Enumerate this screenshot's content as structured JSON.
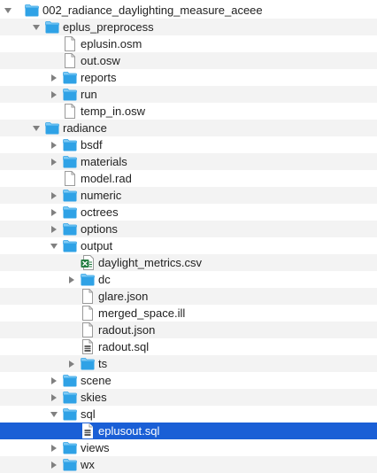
{
  "colors": {
    "folder": "#2fa2e6",
    "folder_tab": "#7fcaf4",
    "selection": "#1a5fd6",
    "alternate_row": "#f3f3f3",
    "disclosure_triangle": "#808080",
    "excel_green": "#1f7a3d"
  },
  "tree": [
    {
      "depth": 0,
      "label": "002_radiance_daylighting_measure_aceee",
      "icon": "folder-icon",
      "expand": "expanded"
    },
    {
      "depth": 1,
      "label": "eplus_preprocess",
      "icon": "folder-icon",
      "expand": "expanded"
    },
    {
      "depth": 2,
      "label": "eplusin.osm",
      "icon": "document-icon",
      "expand": "none"
    },
    {
      "depth": 2,
      "label": "out.osw",
      "icon": "document-icon",
      "expand": "none"
    },
    {
      "depth": 2,
      "label": "reports",
      "icon": "folder-icon",
      "expand": "collapsed"
    },
    {
      "depth": 2,
      "label": "run",
      "icon": "folder-icon",
      "expand": "collapsed"
    },
    {
      "depth": 2,
      "label": "temp_in.osw",
      "icon": "document-icon",
      "expand": "none"
    },
    {
      "depth": 1,
      "label": "radiance",
      "icon": "folder-icon",
      "expand": "expanded"
    },
    {
      "depth": 2,
      "label": "bsdf",
      "icon": "folder-icon",
      "expand": "collapsed"
    },
    {
      "depth": 2,
      "label": "materials",
      "icon": "folder-icon",
      "expand": "collapsed"
    },
    {
      "depth": 2,
      "label": "model.rad",
      "icon": "document-icon",
      "expand": "none"
    },
    {
      "depth": 2,
      "label": "numeric",
      "icon": "folder-icon",
      "expand": "collapsed"
    },
    {
      "depth": 2,
      "label": "octrees",
      "icon": "folder-icon",
      "expand": "collapsed"
    },
    {
      "depth": 2,
      "label": "options",
      "icon": "folder-icon",
      "expand": "collapsed"
    },
    {
      "depth": 2,
      "label": "output",
      "icon": "folder-icon",
      "expand": "expanded"
    },
    {
      "depth": 3,
      "label": "daylight_metrics.csv",
      "icon": "excel-csv-icon",
      "expand": "none"
    },
    {
      "depth": 3,
      "label": "dc",
      "icon": "folder-icon",
      "expand": "collapsed"
    },
    {
      "depth": 3,
      "label": "glare.json",
      "icon": "document-icon",
      "expand": "none"
    },
    {
      "depth": 3,
      "label": "merged_space.ill",
      "icon": "document-icon",
      "expand": "none"
    },
    {
      "depth": 3,
      "label": "radout.json",
      "icon": "document-icon",
      "expand": "none"
    },
    {
      "depth": 3,
      "label": "radout.sql",
      "icon": "database-document-icon",
      "expand": "none"
    },
    {
      "depth": 3,
      "label": "ts",
      "icon": "folder-icon",
      "expand": "collapsed"
    },
    {
      "depth": 2,
      "label": "scene",
      "icon": "folder-icon",
      "expand": "collapsed"
    },
    {
      "depth": 2,
      "label": "skies",
      "icon": "folder-icon",
      "expand": "collapsed"
    },
    {
      "depth": 2,
      "label": "sql",
      "icon": "folder-icon",
      "expand": "expanded"
    },
    {
      "depth": 3,
      "label": "eplusout.sql",
      "icon": "database-document-icon",
      "expand": "none",
      "selected": true
    },
    {
      "depth": 2,
      "label": "views",
      "icon": "folder-icon",
      "expand": "collapsed"
    },
    {
      "depth": 2,
      "label": "wx",
      "icon": "folder-icon",
      "expand": "collapsed"
    }
  ]
}
